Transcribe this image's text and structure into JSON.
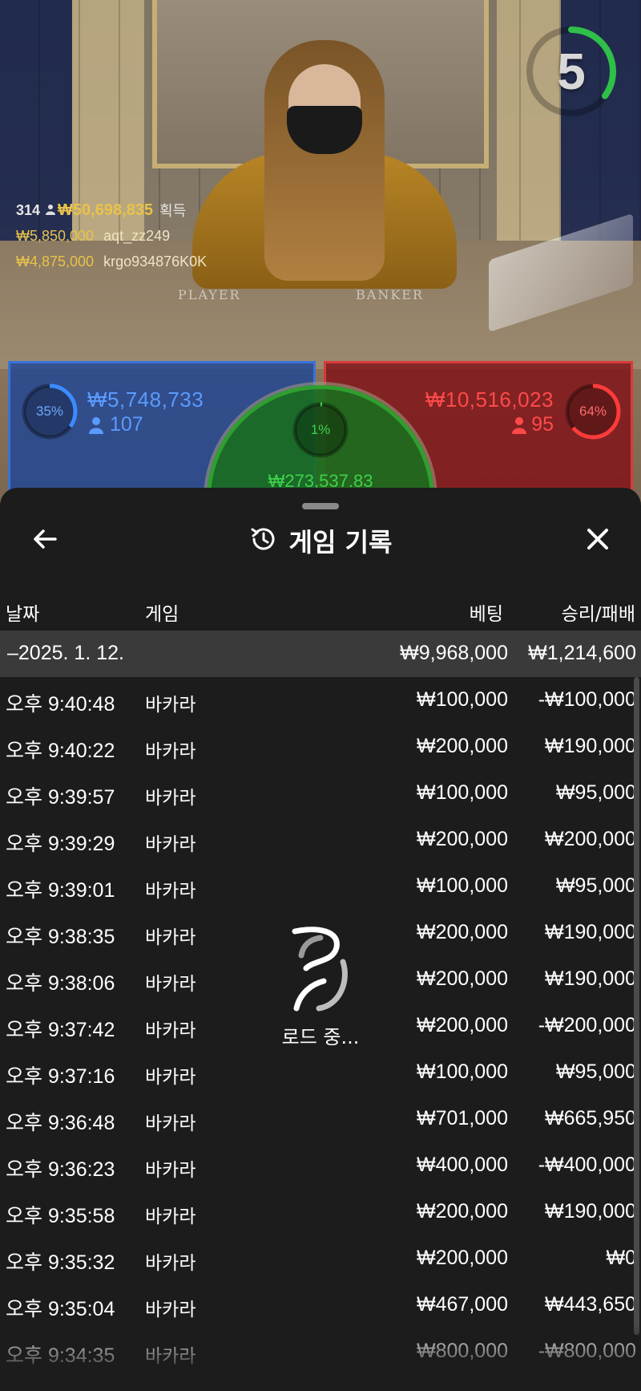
{
  "live": {
    "timer": "5",
    "timer_progress": 0.35,
    "table_labels": [
      "PLAYER",
      "BANKER"
    ],
    "winners_summary": {
      "count": "314",
      "total": "₩50,698,835",
      "label": "획득"
    },
    "top_winners": [
      {
        "amount": "₩5,850,000",
        "nickname": "aqt_zz249"
      },
      {
        "amount": "₩4,875,000",
        "nickname": "krgo934876K0K"
      }
    ]
  },
  "bets": {
    "player": {
      "percent": "35%",
      "percent_value": 0.35,
      "amount": "₩5,748,733",
      "count": "107"
    },
    "banker": {
      "percent": "64%",
      "percent_value": 0.64,
      "amount": "₩10,516,023",
      "count": "95"
    },
    "tie": {
      "percent": "1%",
      "percent_value": 0.01,
      "amount": "₩273,537.83"
    }
  },
  "history": {
    "title": "게임 기록",
    "columns": {
      "date": "날짜",
      "game": "게임",
      "bet": "베팅",
      "result": "승리/패배"
    },
    "summary": {
      "date": "–2025. 1. 12.",
      "bet": "₩9,968,000",
      "result": "₩1,214,600"
    },
    "rows": [
      {
        "time": "오후 9:40:48",
        "game": "바카라",
        "bet": "₩100,000",
        "result": "-₩100,000"
      },
      {
        "time": "오후 9:40:22",
        "game": "바카라",
        "bet": "₩200,000",
        "result": "₩190,000"
      },
      {
        "time": "오후 9:39:57",
        "game": "바카라",
        "bet": "₩100,000",
        "result": "₩95,000"
      },
      {
        "time": "오후 9:39:29",
        "game": "바카라",
        "bet": "₩200,000",
        "result": "₩200,000"
      },
      {
        "time": "오후 9:39:01",
        "game": "바카라",
        "bet": "₩100,000",
        "result": "₩95,000"
      },
      {
        "time": "오후 9:38:35",
        "game": "바카라",
        "bet": "₩200,000",
        "result": "₩190,000"
      },
      {
        "time": "오후 9:38:06",
        "game": "바카라",
        "bet": "₩200,000",
        "result": "₩190,000"
      },
      {
        "time": "오후 9:37:42",
        "game": "바카라",
        "bet": "₩200,000",
        "result": "-₩200,000"
      },
      {
        "time": "오후 9:37:16",
        "game": "바카라",
        "bet": "₩100,000",
        "result": "₩95,000"
      },
      {
        "time": "오후 9:36:48",
        "game": "바카라",
        "bet": "₩701,000",
        "result": "₩665,950"
      },
      {
        "time": "오후 9:36:23",
        "game": "바카라",
        "bet": "₩400,000",
        "result": "-₩400,000"
      },
      {
        "time": "오후 9:35:58",
        "game": "바카라",
        "bet": "₩200,000",
        "result": "₩190,000"
      },
      {
        "time": "오후 9:35:32",
        "game": "바카라",
        "bet": "₩200,000",
        "result": "₩0"
      },
      {
        "time": "오후 9:35:04",
        "game": "바카라",
        "bet": "₩467,000",
        "result": "₩443,650"
      },
      {
        "time": "오후 9:34:35",
        "game": "바카라",
        "bet": "₩800,000",
        "result": "-₩800,000"
      }
    ],
    "loading_text": "로드 중..."
  },
  "icons": {
    "back": "arrow-left-icon",
    "history": "history-clock-icon",
    "close": "close-icon",
    "loader": "loading-spinner-icon",
    "person": "person-icon"
  },
  "colors": {
    "player": "#3a73d9",
    "banker": "#d93a3a",
    "tie": "#3fd14a",
    "winnings": "#e8c34a",
    "sheet_bg": "#1c1c1c",
    "summary_bg": "#3a3a3a"
  }
}
